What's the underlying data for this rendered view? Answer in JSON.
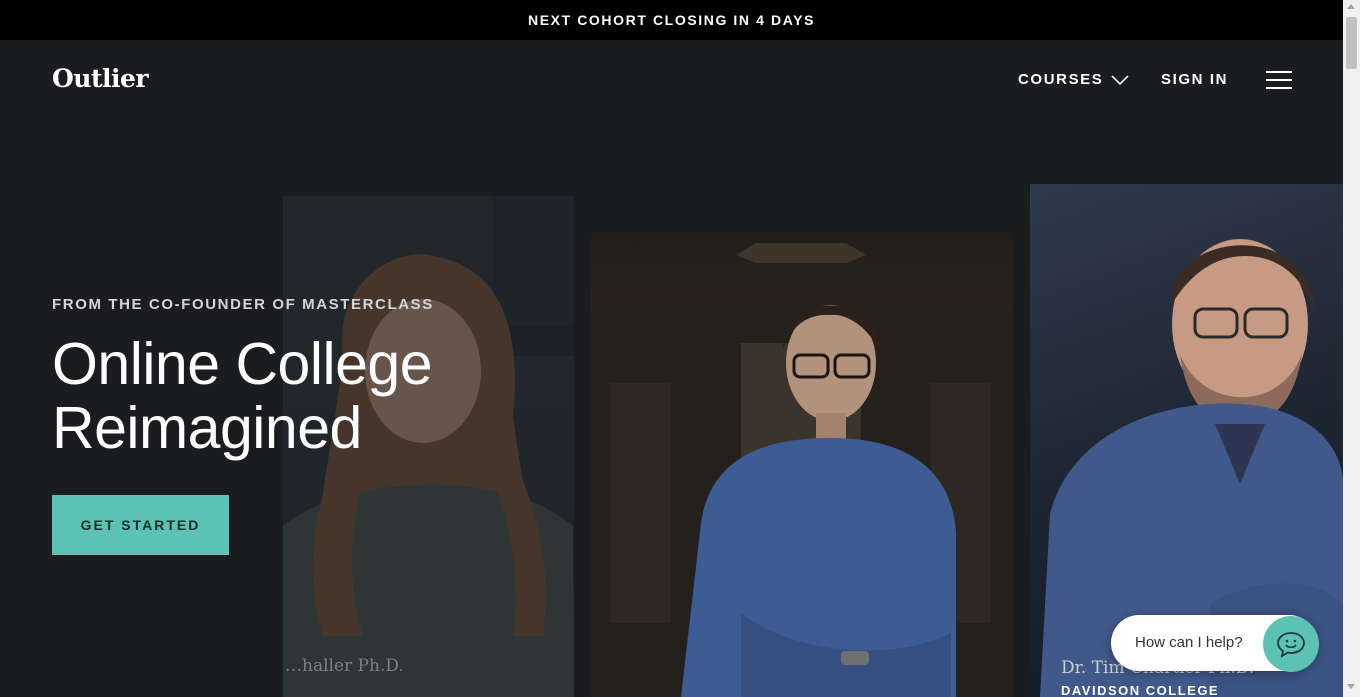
{
  "announcement": {
    "text": "NEXT COHORT CLOSING IN 4 DAYS"
  },
  "nav": {
    "logo": "Outlier",
    "courses_label": "COURSES",
    "signin_label": "SIGN IN"
  },
  "hero": {
    "eyebrow": "FROM THE CO-FOUNDER OF MASTERCLASS",
    "title_line1": "Online College",
    "title_line2": "Reimagined",
    "cta_label": "GET STARTED"
  },
  "instructors": [
    {
      "name": "…haller Ph.D.",
      "school": ""
    },
    {
      "name": "",
      "school": ""
    },
    {
      "name": "Dr. Tim Chartier Ph.D.",
      "school": "DAVIDSON COLLEGE"
    }
  ],
  "chat": {
    "prompt": "How can I help?"
  },
  "colors": {
    "accent": "#5bc2b4",
    "background": "#1b1c20",
    "announcement_bg": "#000000"
  },
  "icons": {
    "courses_caret": "chevron-down-icon",
    "menu": "hamburger-menu-icon",
    "chat": "chat-bubble-icon"
  }
}
